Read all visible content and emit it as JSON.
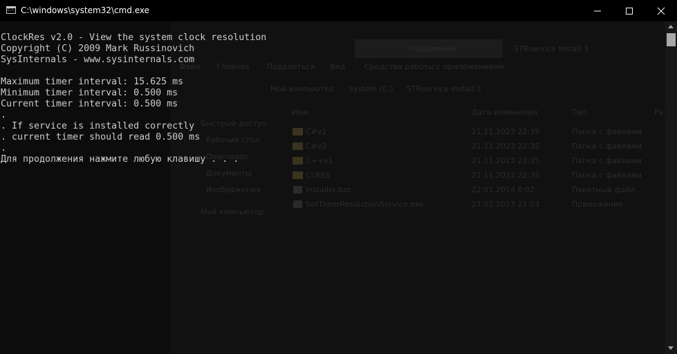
{
  "window": {
    "title": "C:\\windows\\system32\\cmd.exe",
    "icon_text": "C:\\",
    "controls": [
      "minimize-icon",
      "maximize-icon",
      "close-icon"
    ]
  },
  "console": {
    "lines": [
      "ClockRes v2.0 - View the system clock resolution",
      "Copyright (C) 2009 Mark Russinovich",
      "SysInternals - www.sysinternals.com",
      "",
      "Maximum timer interval: 15.625 ms",
      "Minimum timer interval: 0.500 ms",
      "Current timer interval: 0.500 ms",
      ".",
      ". If service is installed correctly",
      ". current timer should read 0.500 ms",
      ".",
      "Для продолжения нажмите любую клавишу . . ."
    ]
  },
  "background_explorer": {
    "ribbon_button": "Управление",
    "window_title": "STRservice Install 3",
    "menu": [
      "Файл",
      "Главная",
      "Поделиться",
      "Вид",
      "Средства работы с приложениями"
    ],
    "breadcrumb": [
      "Мой компьютер",
      "System (C:)",
      "STRservice Install 3"
    ],
    "columns": [
      "Имя",
      "Дата изменения",
      "Тип",
      "Разм"
    ],
    "sidebar": [
      "Быстрый доступ",
      "Рабочий стол",
      "Downloads",
      "Документы",
      "Изображения",
      "Мой компьютер"
    ],
    "files": [
      {
        "name": "C#v1",
        "date": "21.11.2023 22:35",
        "type": "Папка с файлами",
        "kind": "folder"
      },
      {
        "name": "C#v2",
        "date": "21.11.2023 22:35",
        "type": "Папка с файлами",
        "kind": "folder"
      },
      {
        "name": "C++v1",
        "date": "21.11.2023 22:35",
        "type": "Папка с файлами",
        "kind": "folder"
      },
      {
        "name": "CLRES",
        "date": "21.11.2023 22:35",
        "type": "Папка с файлами",
        "kind": "folder"
      },
      {
        "name": "Installer.bat",
        "date": "22.01.2014 8:02",
        "type": "Пакетный файл ...",
        "kind": "file"
      },
      {
        "name": "SetTimerResolutionService.exe",
        "date": "27.02.2013 21:03",
        "type": "Приложение",
        "kind": "file"
      }
    ]
  }
}
